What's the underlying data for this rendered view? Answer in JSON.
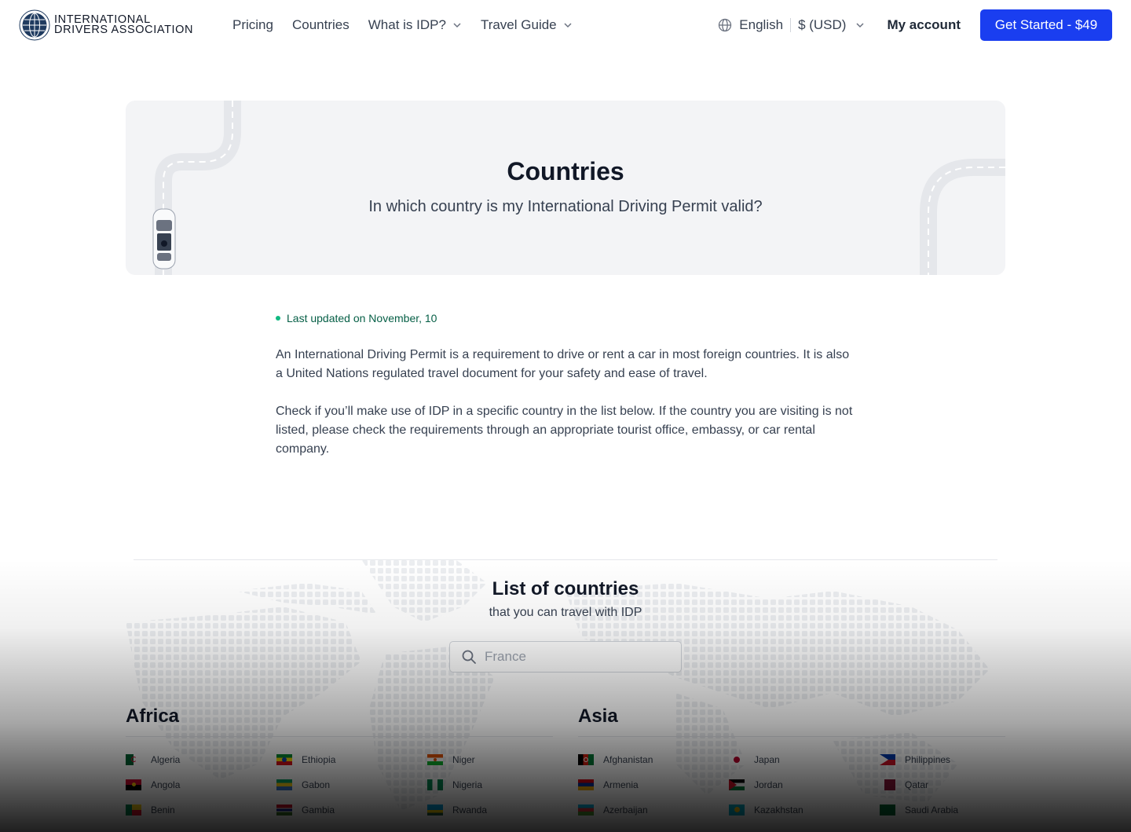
{
  "header": {
    "logo": {
      "line1": "INTERNATIONAL",
      "line2": "DRIVERS ASSOCIATION"
    },
    "nav": [
      {
        "label": "Pricing",
        "has_dropdown": false
      },
      {
        "label": "Countries",
        "has_dropdown": false
      },
      {
        "label": "What is IDP?",
        "has_dropdown": true
      },
      {
        "label": "Travel Guide",
        "has_dropdown": true
      }
    ],
    "language": "English",
    "currency": "$ (USD)",
    "account": "My account",
    "cta": "Get Started - $49",
    "cta_color": "#1a3ef0"
  },
  "hero": {
    "title": "Countries",
    "subtitle": "In which country is my International Driving Permit valid?"
  },
  "content": {
    "last_updated": "Last updated on November, 10",
    "paragraph1": "An International Driving Permit is a requirement to drive or rent a car in most foreign countries. It is also a United Nations regulated travel document for your safety and ease of travel.",
    "paragraph2": "Check if you’ll make use of IDP in a specific country in the list below. If the country you are visiting is not listed, please check the requirements through an appropriate tourist office, embassy, or car rental company."
  },
  "countries_section": {
    "title": "List of countries",
    "subtitle": "that you can travel with IDP",
    "search_placeholder": "France",
    "regions": [
      {
        "name": "Africa",
        "countries": [
          "Algeria",
          "Angola",
          "Benin",
          "Ethiopia",
          "Gabon",
          "Gambia",
          "Niger",
          "Nigeria",
          "Rwanda"
        ]
      },
      {
        "name": "Asia",
        "countries": [
          "Afghanistan",
          "Armenia",
          "Azerbaijan",
          "Japan",
          "Jordan",
          "Kazakhstan",
          "Philippines",
          "Qatar",
          "Saudi Arabia"
        ]
      }
    ]
  }
}
